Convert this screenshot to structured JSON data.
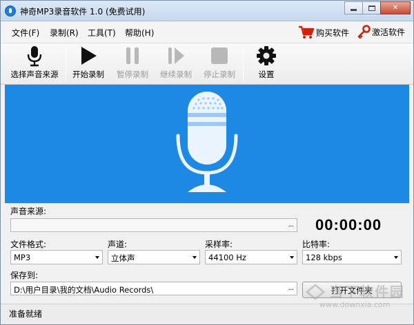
{
  "window": {
    "title": "神奇MP3录音软件 1.0 (免费试用)",
    "close_glyph": "✕"
  },
  "menu": {
    "items": [
      "文件(F)",
      "录制(R)",
      "工具(T)",
      "帮助(H)"
    ],
    "buy": "购买软件",
    "activate": "激活软件"
  },
  "toolbar": {
    "items": [
      {
        "label": "选择声音来源",
        "icon": "microphone-icon",
        "enabled": true
      },
      {
        "label": "开始录制",
        "icon": "play-icon",
        "enabled": true
      },
      {
        "label": "暂停录制",
        "icon": "pause-icon",
        "enabled": false
      },
      {
        "label": "继续录制",
        "icon": "resume-icon",
        "enabled": false
      },
      {
        "label": "停止录制",
        "icon": "stop-icon",
        "enabled": false
      },
      {
        "label": "设置",
        "icon": "gear-icon",
        "enabled": true
      }
    ]
  },
  "colors": {
    "banner": "#1e88e5",
    "cart": "#d81e06",
    "key": "#d81e06"
  },
  "form": {
    "source_label": "声音来源:",
    "source_value": "",
    "browse": "...",
    "timer": "00:00:00",
    "format_label": "文件格式:",
    "format_value": "MP3",
    "channel_label": "声道:",
    "channel_value": "立体声",
    "samplerate_label": "采样率:",
    "samplerate_value": "44100 Hz",
    "bitrate_label": "比特率:",
    "bitrate_value": "128 kbps",
    "save_label": "保存到:",
    "save_value": "D:\\用户目录\\我的文档\\Audio Records\\",
    "open_folder": "打开文件夹"
  },
  "status": {
    "text": "准备就绪"
  },
  "watermark": {
    "line1": "当下软件园",
    "line2": "www.downxia.com"
  }
}
